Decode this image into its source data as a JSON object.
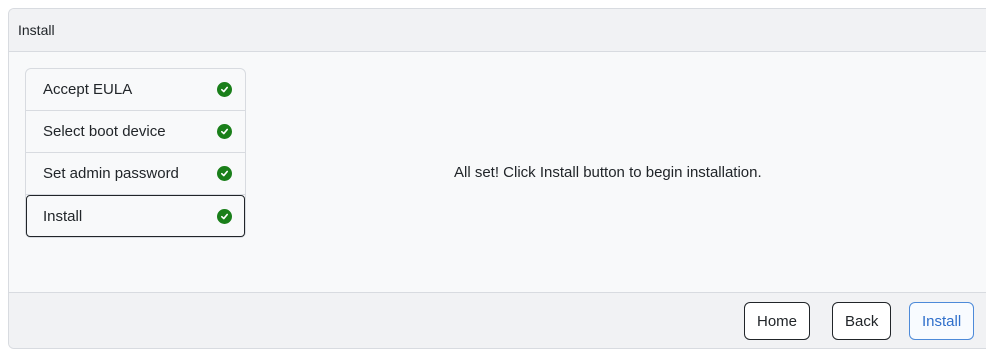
{
  "header": {
    "title": "Install"
  },
  "steps": [
    {
      "label": "Accept EULA",
      "status": "complete"
    },
    {
      "label": "Select boot device",
      "status": "complete"
    },
    {
      "label": "Set admin password",
      "status": "complete"
    },
    {
      "label": "Install",
      "status": "complete",
      "active": true
    }
  ],
  "message": "All set! Click Install button to begin installation.",
  "footer": {
    "home_label": "Home",
    "back_label": "Back",
    "install_label": "Install"
  },
  "colors": {
    "check_green": "#1a7f1a",
    "primary_blue": "#2f6fcb"
  }
}
